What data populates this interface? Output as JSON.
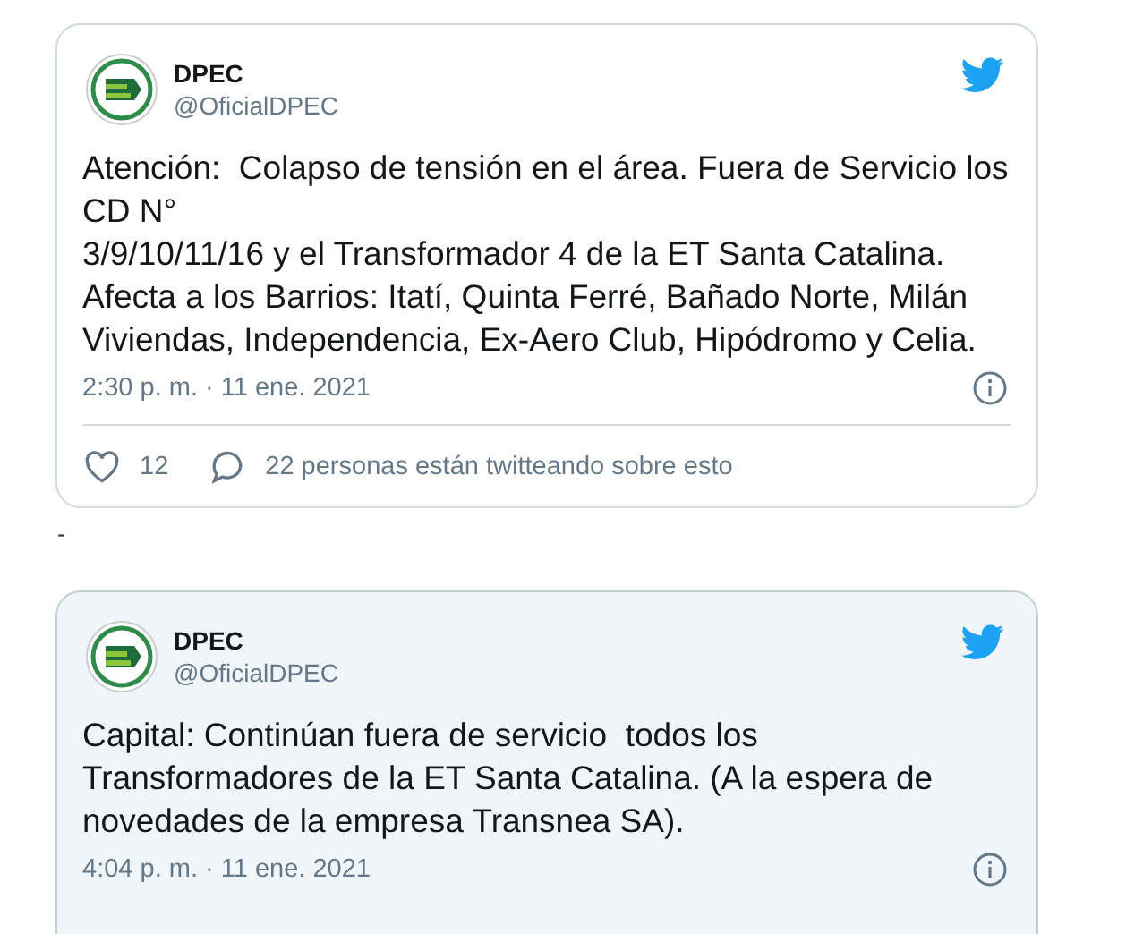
{
  "tweets": [
    {
      "name": "DPEC",
      "handle": "@OficialDPEC",
      "hovered": false,
      "text": "Atención:  Colapso de tensión en el área. Fuera de Servicio los\nCD N°\n3/9/10/11/16 y el Transformador 4 de la ET Santa Catalina.\nAfecta a los Barrios: Itatí, Quinta Ferré, Bañado Norte, Milán\nViviendas, Independencia, Ex-Aero Club, Hipódromo y Celia.",
      "time": "2:30 p. m. · 11 ene. 2021",
      "likes": "12",
      "talking": "22 personas están twitteando sobre esto"
    },
    {
      "name": "DPEC",
      "handle": "@OficialDPEC",
      "hovered": true,
      "text": "Capital: Continúan fuera de servicio  todos los\nTransformadores de la ET Santa Catalina. (A la espera de\nnovedades de la empresa Transnea SA).",
      "time": "4:04 p. m. · 11 ene. 2021"
    }
  ],
  "separator": "-"
}
